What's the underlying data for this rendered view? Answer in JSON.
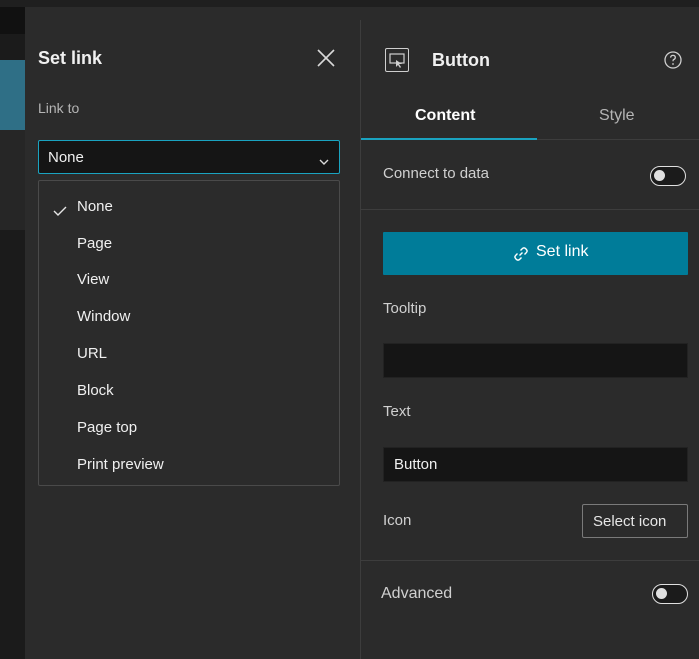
{
  "setlink": {
    "title": "Set link",
    "link_to_label": "Link to",
    "selected": "None",
    "options": [
      "None",
      "Page",
      "View",
      "Window",
      "URL",
      "Block",
      "Page top",
      "Print preview"
    ]
  },
  "props": {
    "title": "Button",
    "tabs": [
      {
        "label": "Content",
        "active": true
      },
      {
        "label": "Style",
        "active": false
      }
    ],
    "connect_label": "Connect to data",
    "connect_on": false,
    "setlink_button": "Set link",
    "tooltip_label": "Tooltip",
    "tooltip_value": "",
    "text_label": "Text",
    "text_value": "Button",
    "icon_label": "Icon",
    "select_icon_button": "Select icon",
    "advanced_label": "Advanced",
    "advanced_on": false
  },
  "colors": {
    "accent": "#1aa3c0",
    "primary_button": "#007c99",
    "panel_bg": "#2b2b2b",
    "input_bg": "#151515"
  }
}
